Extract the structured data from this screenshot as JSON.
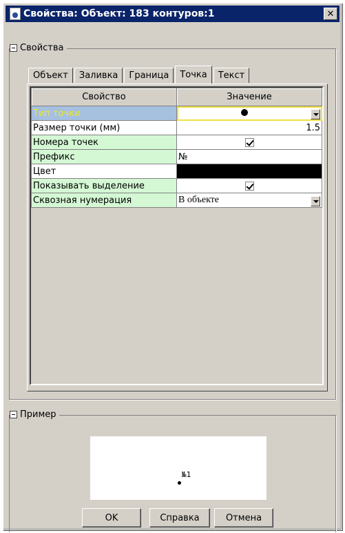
{
  "window": {
    "title": "Свойства: Объект: 183 контуров:1",
    "close_symbol": "✕"
  },
  "properties_group": {
    "label": "Свойства"
  },
  "tabs": [
    {
      "label": "Объект",
      "active": false
    },
    {
      "label": "Заливка",
      "active": false
    },
    {
      "label": "Граница",
      "active": false
    },
    {
      "label": "Точка",
      "active": true
    },
    {
      "label": "Текст",
      "active": false
    }
  ],
  "grid": {
    "col_property": "Свойство",
    "col_value": "Значение",
    "rows": [
      {
        "property": "Тип точки",
        "value_kind": "dot-dropdown",
        "selected": true
      },
      {
        "property": "Размер точки (мм)",
        "value": "1.5"
      },
      {
        "property": "Номера точек",
        "value_kind": "checkbox",
        "checked": true
      },
      {
        "property": "Префикс",
        "value": "№"
      },
      {
        "property": "Цвет",
        "value_kind": "color",
        "color": "#000000"
      },
      {
        "property": "Показывать выделение",
        "value_kind": "checkbox",
        "checked": true
      },
      {
        "property": "Сквозная нумерация",
        "value": "В объекте",
        "value_kind": "dropdown"
      }
    ]
  },
  "example_group": {
    "label": "Пример"
  },
  "preview": {
    "point_label": "№1"
  },
  "buttons": {
    "ok": "OK",
    "help": "Справка",
    "cancel": "Отмена"
  },
  "colors": {
    "titlebar": "#0a246a",
    "window_bg": "#d4d0c8",
    "property_bg": "#d4f8d4",
    "selected_bg": "#a6c0e0",
    "selected_text": "#f2e81c"
  }
}
